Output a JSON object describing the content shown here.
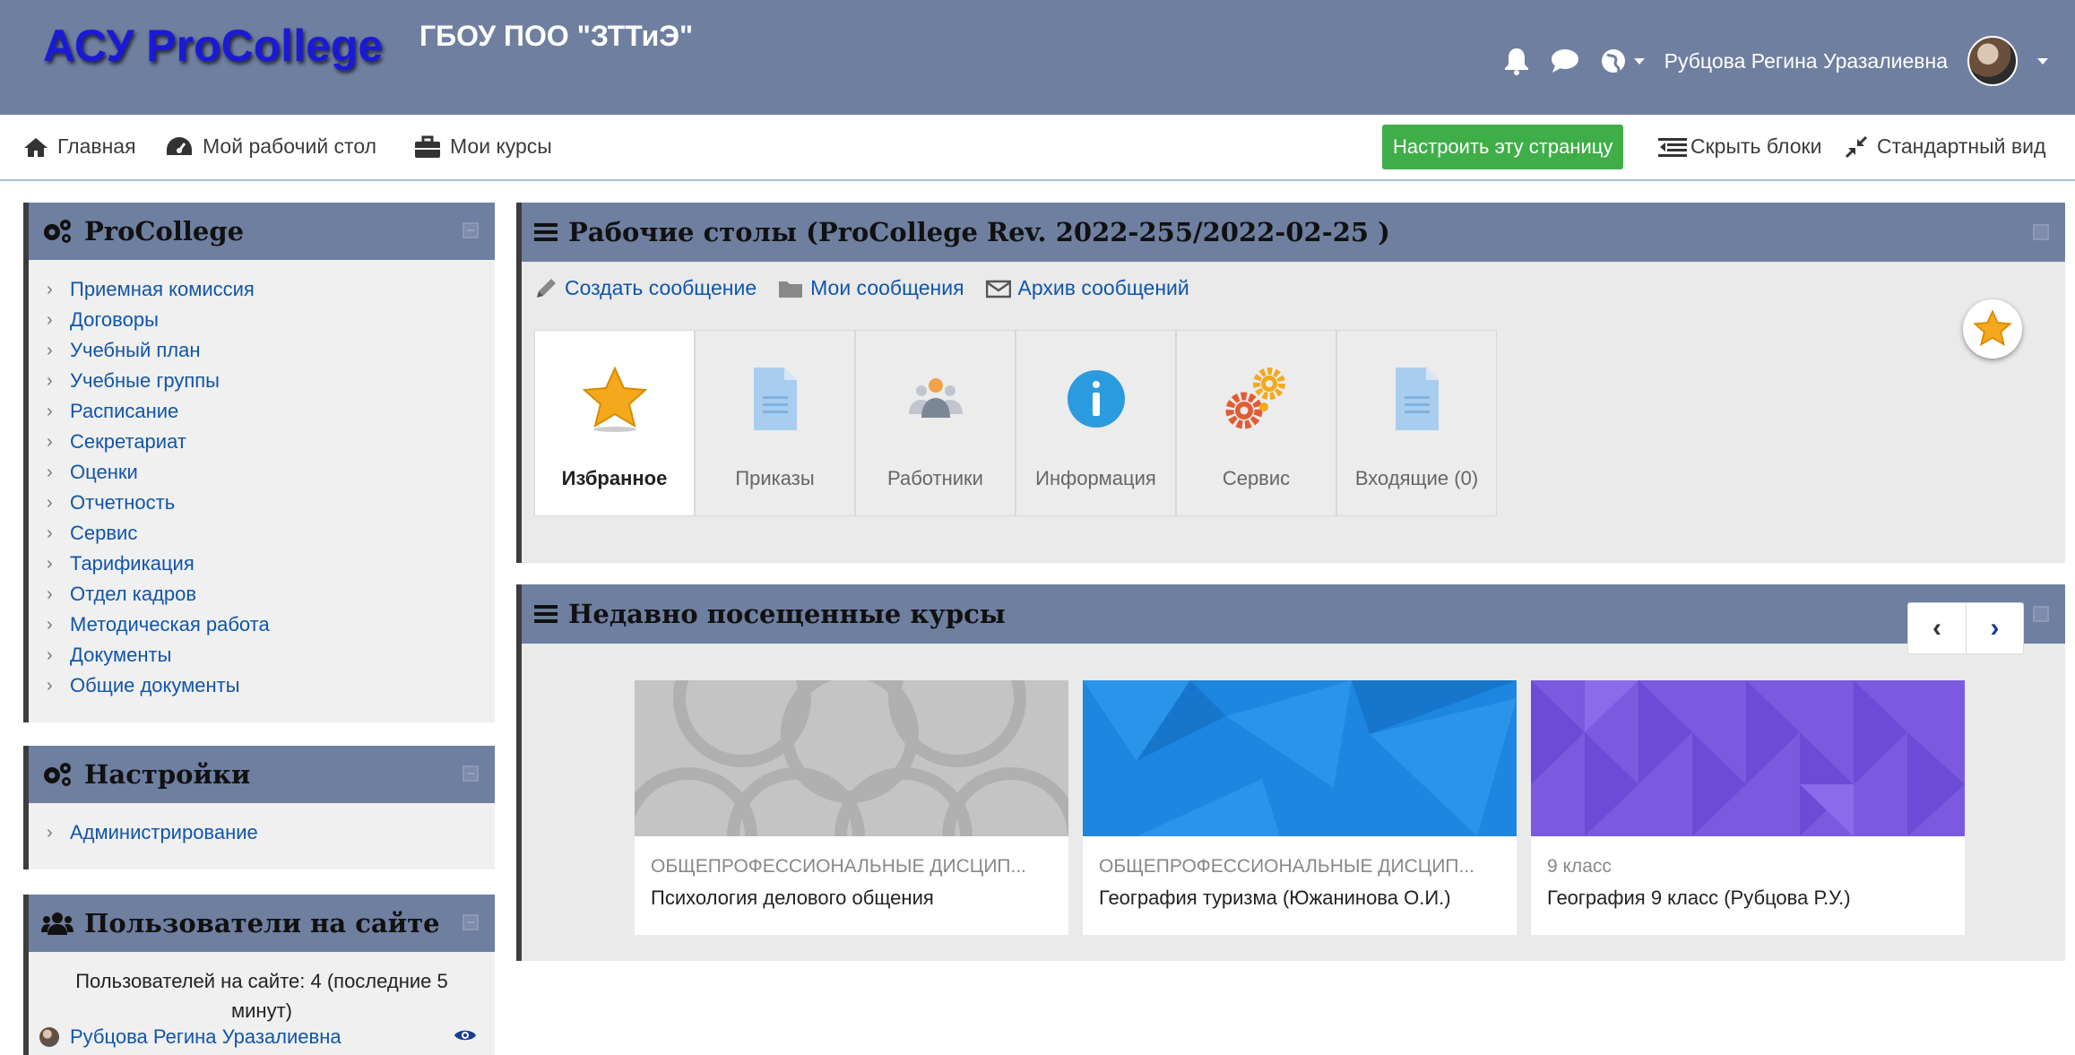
{
  "header": {
    "logo": "АСУ ProCollege",
    "org": "ГБОУ ПОО \"ЗТТиЭ\"",
    "user_name": "Рубцова Регина Уразалиевна"
  },
  "nav": {
    "home": "Главная",
    "dashboard": "Мой рабочий стол",
    "my_courses": "Мои курсы",
    "customize": "Настроить эту страницу",
    "hide_blocks": "Скрыть блоки",
    "standard_view": "Стандартный вид"
  },
  "procollege_block": {
    "title": "ProCollege",
    "items": [
      "Приемная комиссия",
      "Договоры",
      "Учебный план",
      "Учебные группы",
      "Расписание",
      "Секретариат",
      "Оценки",
      "Отчетность",
      "Сервис",
      "Тарификация",
      "Отдел кадров",
      "Методическая работа",
      "Документы",
      "Общие документы"
    ]
  },
  "settings_block": {
    "title": "Настройки",
    "items": [
      "Администрирование"
    ]
  },
  "online_block": {
    "title": "Пользователи на сайте",
    "summary": "Пользователей на сайте: 4 (последние 5 минут)",
    "user": "Рубцова Регина Уразалиевна"
  },
  "desktops_block": {
    "title": "Рабочие столы (ProCollege Rev. 2022-255/2022-02-25 )",
    "links": {
      "create": "Создать сообщение",
      "my_messages": "Мои сообщения",
      "archive": "Архив сообщений"
    },
    "tiles": [
      "Избранное",
      "Приказы",
      "Работники",
      "Информация",
      "Сервис",
      "Входящие (0)"
    ]
  },
  "recent_block": {
    "title": "Недавно посещенные курсы",
    "cards": [
      {
        "category": "ОБЩЕПРОФЕССИОНАЛЬНЫЕ ДИСЦИП...",
        "title": "Психология делового общения"
      },
      {
        "category": "ОБЩЕПРОФЕССИОНАЛЬНЫЕ ДИСЦИП...",
        "title": "География туризма (Южанинова О.И.)"
      },
      {
        "category": "9 класс",
        "title": "География 9 класс (Рубцова Р.У.)"
      }
    ]
  },
  "colors": {
    "header_bg": "#6f7fa0",
    "link": "#1155a8",
    "customize_bg": "#3fae49",
    "card_gray": "#bdbdbd",
    "card_blue": "#1d86e0",
    "card_purple": "#7b5ae0"
  },
  "icons": {
    "nav": [
      "home-icon",
      "dashboard-icon",
      "briefcase-icon",
      "hide-blocks-icon",
      "standard-view-icon"
    ],
    "header": [
      "bell-icon",
      "chat-icon",
      "globe-icon"
    ]
  }
}
